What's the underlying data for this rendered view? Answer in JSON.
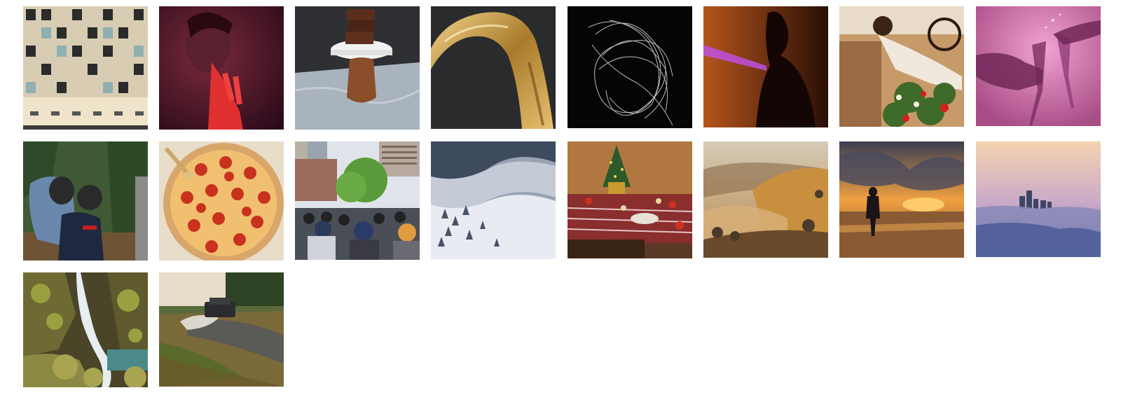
{
  "gallery": {
    "items": [
      {
        "id": "building-facade",
        "subject": "building-facade"
      },
      {
        "id": "woman-red-light",
        "subject": "woman-red-light"
      },
      {
        "id": "brownies-on-stand",
        "subject": "brownies-on-stand"
      },
      {
        "id": "gold-ribbon",
        "subject": "gold-ribbon"
      },
      {
        "id": "wire-scribble",
        "subject": "wire-scribble"
      },
      {
        "id": "silhouette-beam",
        "subject": "silhouette-beam"
      },
      {
        "id": "woman-in-car-flowers",
        "subject": "woman-in-car-flowers"
      },
      {
        "id": "wine-glasses-toast",
        "subject": "wine-glasses-toast"
      },
      {
        "id": "kids-christmas-trees",
        "subject": "kids-christmas-trees"
      },
      {
        "id": "pepperoni-pizza",
        "subject": "pepperoni-pizza"
      },
      {
        "id": "street-crowd",
        "subject": "street-crowd"
      },
      {
        "id": "snowy-mountain-valley",
        "subject": "snowy-mountain-valley"
      },
      {
        "id": "holiday-dinner-table",
        "subject": "holiday-dinner-table"
      },
      {
        "id": "misty-sunrise-hills",
        "subject": "misty-sunrise-hills"
      },
      {
        "id": "beach-sunset-silhouette",
        "subject": "beach-sunset-silhouette"
      },
      {
        "id": "city-above-clouds",
        "subject": "city-above-clouds"
      },
      {
        "id": "mossy-waterfall",
        "subject": "mossy-waterfall"
      },
      {
        "id": "vintage-car-dust",
        "subject": "vintage-car-dust"
      }
    ]
  }
}
